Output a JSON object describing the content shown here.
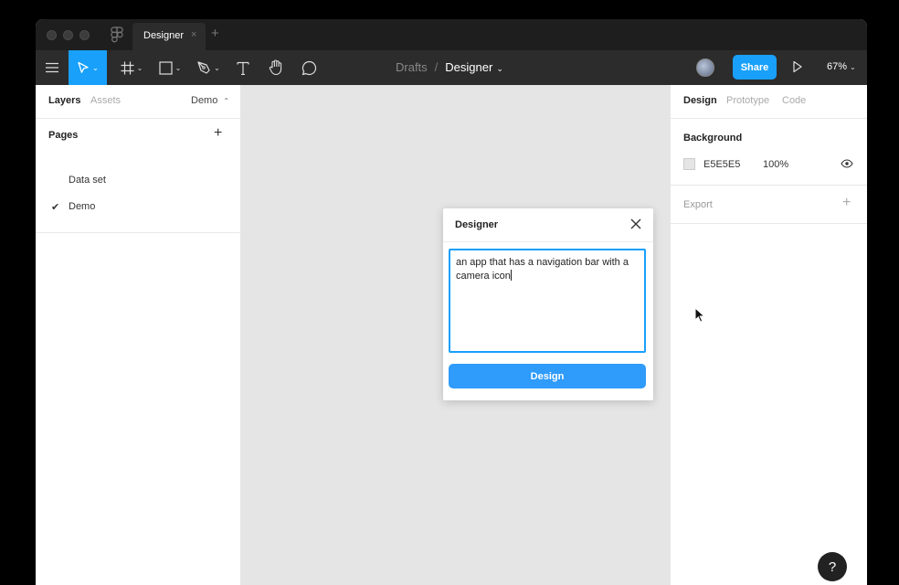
{
  "titlebar": {
    "tab_label": "Designer",
    "tab_close": "×",
    "new_tab": "+"
  },
  "toolbar": {
    "tools": [
      "main-menu-icon",
      "move-tool-icon",
      "frame-tool-icon",
      "shape-tool-icon",
      "pen-tool-icon",
      "text-tool-icon",
      "hand-tool-icon",
      "comment-tool-icon"
    ],
    "active_tool": "move-tool-icon",
    "breadcrumb_folder": "Drafts",
    "breadcrumb_separator": "/",
    "breadcrumb_file": "Designer",
    "share_label": "Share",
    "zoom_label": "67%"
  },
  "left_panel": {
    "tab_layers": "Layers",
    "tab_assets": "Assets",
    "current_page": "Demo",
    "pages_title": "Pages",
    "pages": [
      {
        "label": "Data set",
        "selected": false
      },
      {
        "label": "Demo",
        "selected": true
      }
    ]
  },
  "modal": {
    "title": "Designer",
    "prompt_text": "an app that has a navigation bar with a camera icon",
    "button_label": "Design"
  },
  "right_panel": {
    "tab_design": "Design",
    "tab_prototype": "Prototype",
    "tab_code": "Code",
    "background_title": "Background",
    "background_hex": "E5E5E5",
    "background_opacity": "100%",
    "export_title": "Export"
  },
  "help": {
    "label": "?"
  },
  "colors": {
    "accent": "#18a0fb",
    "canvas": "#e5e5e5",
    "toolbar": "#2c2c2c"
  }
}
